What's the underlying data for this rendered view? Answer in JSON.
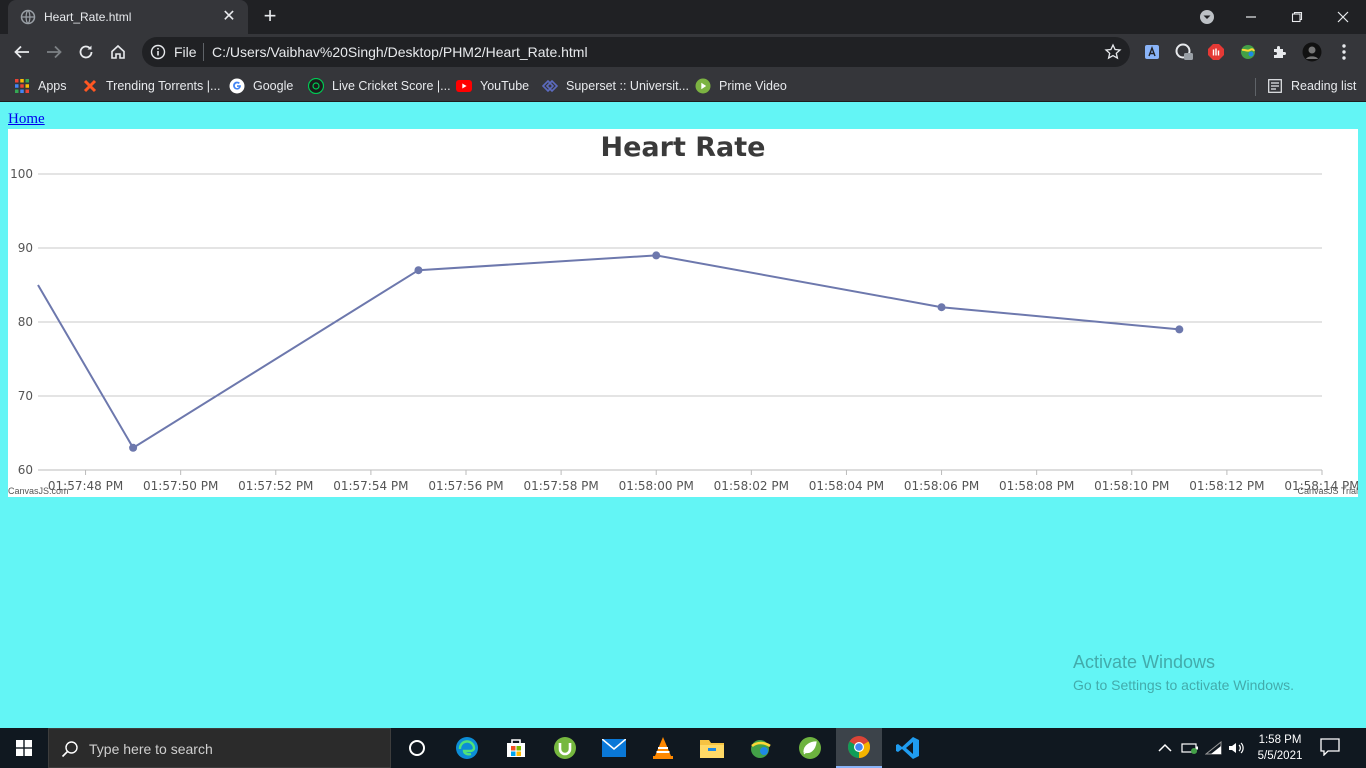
{
  "browser": {
    "tab_title": "Heart_Rate.html",
    "omnibox": {
      "scheme_label": "File",
      "url": "C:/Users/Vaibhav%20Singh/Desktop/PHM2/Heart_Rate.html"
    },
    "bookmarks": [
      {
        "label": "Apps",
        "icon": "apps-grid-icon"
      },
      {
        "label": "Trending Torrents |...",
        "icon": "torrents-x-icon"
      },
      {
        "label": "Google",
        "icon": "google-icon"
      },
      {
        "label": "Live Cricket Score |...",
        "icon": "cricket-icon"
      },
      {
        "label": "YouTube",
        "icon": "youtube-icon"
      },
      {
        "label": "Superset :: Universit...",
        "icon": "superset-icon"
      },
      {
        "label": "Prime Video",
        "icon": "prime-video-icon"
      }
    ],
    "reading_list": "Reading list"
  },
  "page": {
    "home_link": "Home"
  },
  "chart_data": {
    "type": "line",
    "title": "Heart Rate",
    "xlabel": "",
    "ylabel": "",
    "ylim": [
      60,
      100
    ],
    "y_ticks": [
      60,
      70,
      80,
      90,
      100
    ],
    "x_ticks": [
      "01:57:48 PM",
      "01:57:50 PM",
      "01:57:52 PM",
      "01:57:54 PM",
      "01:57:56 PM",
      "01:57:58 PM",
      "01:58:00 PM",
      "01:58:02 PM",
      "01:58:04 PM",
      "01:58:06 PM",
      "01:58:08 PM",
      "01:58:10 PM",
      "01:58:12 PM",
      "01:58:14 PM"
    ],
    "xlim": [
      "01:57:47 PM",
      "01:58:14 PM"
    ],
    "grid": true,
    "series": [
      {
        "x": [
          "01:57:47 PM",
          "01:57:49 PM",
          "01:57:55 PM",
          "01:58:00 PM",
          "01:58:06 PM",
          "01:58:11 PM"
        ],
        "y": [
          85,
          63,
          87,
          89,
          82,
          79
        ],
        "color": "#6d78ad"
      }
    ],
    "credits": {
      "left": "CanvasJS.com",
      "right": "CanvasJS Trial"
    }
  },
  "watermark": {
    "title": "Activate Windows",
    "subtitle": "Go to Settings to activate Windows."
  },
  "taskbar": {
    "search_placeholder": "Type here to search",
    "apps": [
      "cortana-icon",
      "edge-icon",
      "store-icon",
      "utorrent-icon",
      "mail-icon",
      "vlc-icon",
      "file-explorer-icon",
      "ide-icon",
      "spring-icon",
      "chrome-icon",
      "vscode-icon"
    ],
    "time": "1:58 PM",
    "date": "5/5/2021"
  }
}
